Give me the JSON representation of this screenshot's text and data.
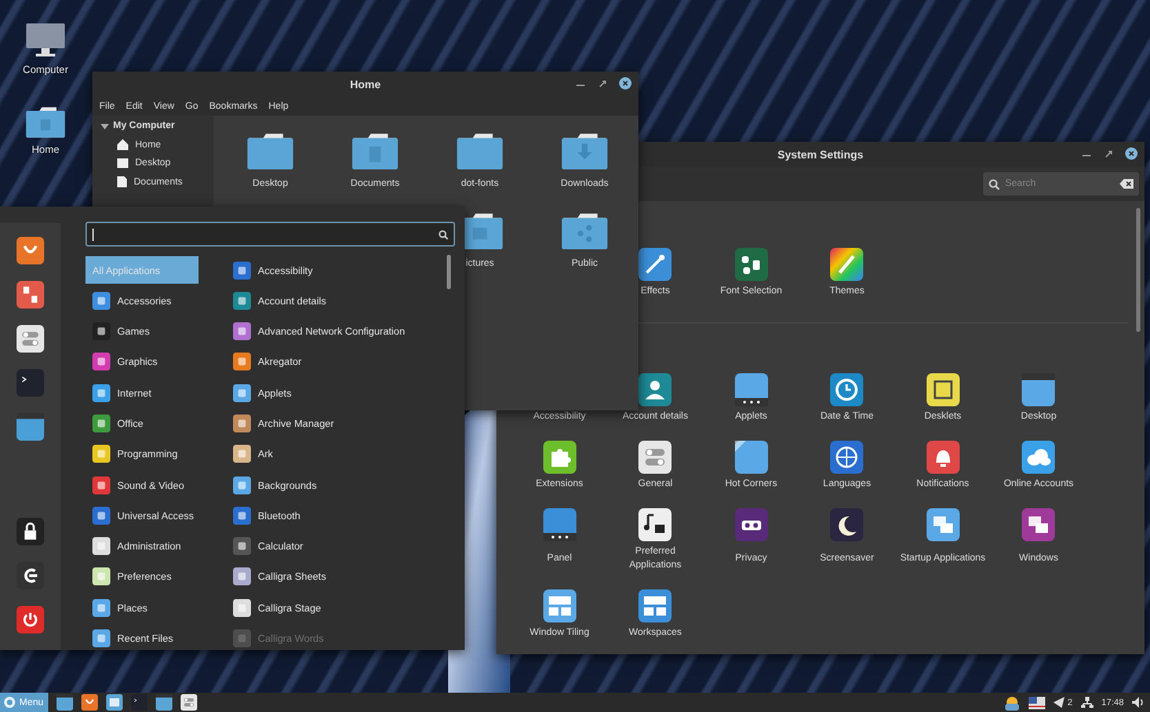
{
  "desktop_icons": [
    {
      "label": "Computer"
    },
    {
      "label": "Home"
    }
  ],
  "home_window": {
    "title": "Home",
    "menu": [
      "File",
      "Edit",
      "View",
      "Go",
      "Bookmarks",
      "Help"
    ],
    "sidebar": {
      "heading": "My Computer",
      "expanded": true,
      "items": [
        "Home",
        "Desktop",
        "Documents"
      ]
    },
    "folders": [
      "Desktop",
      "Documents",
      "dot-fonts",
      "Downloads",
      "ictures",
      "Public"
    ]
  },
  "settings_window": {
    "title": "System Settings",
    "search": {
      "placeholder": "Search"
    },
    "sections": [
      {
        "items": [
          "Effects",
          "Font Selection",
          "Themes"
        ]
      },
      {
        "items": [
          "Accessibility",
          "Account details",
          "Applets",
          "Date & Time",
          "Desklets",
          "Desktop",
          "Extensions",
          "General",
          "Hot Corners",
          "Languages",
          "Notifications",
          "Online Accounts",
          "Panel",
          "Preferred Applications",
          "Privacy",
          "Screensaver",
          "Startup Applications",
          "Windows",
          "Window Tiling",
          "Workspaces"
        ]
      }
    ]
  },
  "menu": {
    "categories": [
      {
        "label": "All Applications",
        "selected": true
      },
      {
        "label": "Accessories",
        "selected": false
      },
      {
        "label": "Games",
        "selected": false
      },
      {
        "label": "Graphics",
        "selected": false
      },
      {
        "label": "Internet",
        "selected": false
      },
      {
        "label": "Office",
        "selected": false
      },
      {
        "label": "Programming",
        "selected": false
      },
      {
        "label": "Sound & Video",
        "selected": false
      },
      {
        "label": "Universal Access",
        "selected": false
      },
      {
        "label": "Administration",
        "selected": false
      },
      {
        "label": "Preferences",
        "selected": false
      },
      {
        "label": "Places",
        "selected": false
      },
      {
        "label": "Recent Files",
        "selected": false
      }
    ],
    "apps": [
      {
        "label": "Accessibility",
        "dimmed": false
      },
      {
        "label": "Account details",
        "dimmed": false
      },
      {
        "label": "Advanced Network Configuration",
        "dimmed": false
      },
      {
        "label": "Akregator",
        "dimmed": false
      },
      {
        "label": "Applets",
        "dimmed": false
      },
      {
        "label": "Archive Manager",
        "dimmed": false
      },
      {
        "label": "Ark",
        "dimmed": false
      },
      {
        "label": "Backgrounds",
        "dimmed": false
      },
      {
        "label": "Bluetooth",
        "dimmed": false
      },
      {
        "label": "Calculator",
        "dimmed": false
      },
      {
        "label": "Calligra Sheets",
        "dimmed": false
      },
      {
        "label": "Calligra Stage",
        "dimmed": false
      },
      {
        "label": "Calligra Words",
        "dimmed": true
      }
    ]
  },
  "taskbar": {
    "menu_button": "Menu",
    "notification_count": "2",
    "clock": "17:48"
  }
}
